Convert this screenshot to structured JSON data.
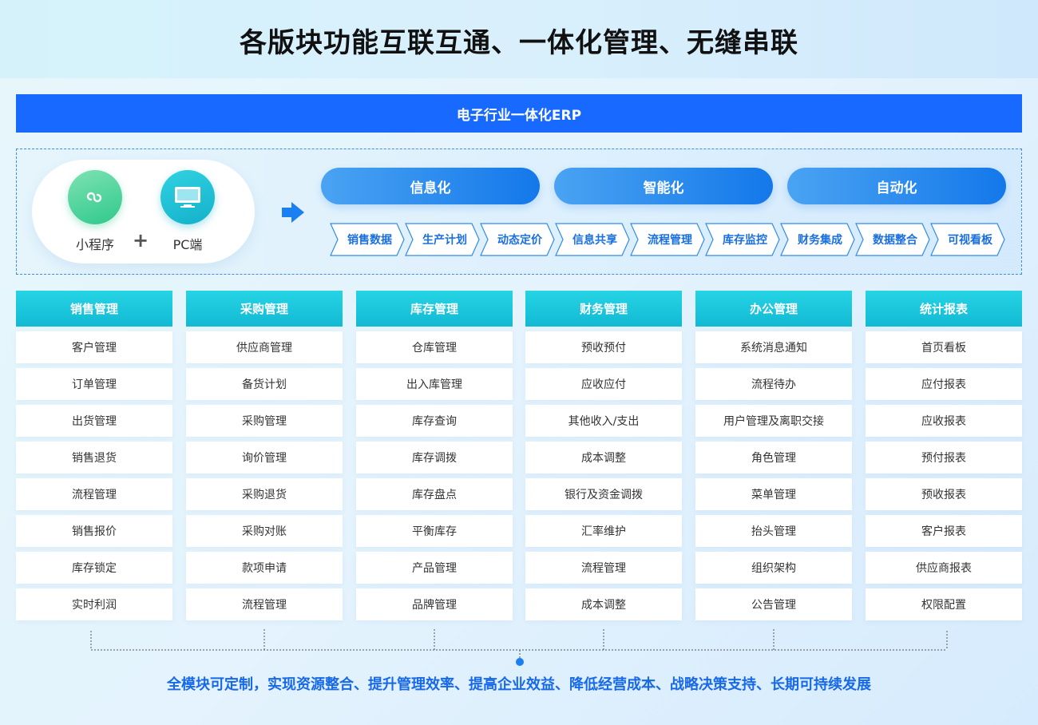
{
  "title": "各版块功能互联互通、一体化管理、无缝串联",
  "erp_bar": "电子行业一体化ERP",
  "platforms": [
    {
      "label": "小程序",
      "icon": "mini-program-icon"
    },
    {
      "label": "PC端",
      "icon": "monitor-icon"
    }
  ],
  "plus": "+",
  "categories": [
    "信息化",
    "智能化",
    "自动化"
  ],
  "features": [
    "销售数据",
    "生产计划",
    "动态定价",
    "信息共享",
    "流程管理",
    "库存监控",
    "财务集成",
    "数据整合",
    "可视看板"
  ],
  "modules": [
    {
      "header": "销售管理",
      "items": [
        "客户管理",
        "订单管理",
        "出货管理",
        "销售退货",
        "流程管理",
        "销售报价",
        "库存锁定",
        "实时利润"
      ]
    },
    {
      "header": "采购管理",
      "items": [
        "供应商管理",
        "备货计划",
        "采购管理",
        "询价管理",
        "采购退货",
        "采购对账",
        "款项申请",
        "流程管理"
      ]
    },
    {
      "header": "库存管理",
      "items": [
        "仓库管理",
        "出入库管理",
        "库存查询",
        "库存调拨",
        "库存盘点",
        "平衡库存",
        "产品管理",
        "品牌管理"
      ]
    },
    {
      "header": "财务管理",
      "items": [
        "预收预付",
        "应收应付",
        "其他收入/支出",
        "成本调整",
        "银行及资金调拨",
        "汇率维护",
        "流程管理",
        "成本调整"
      ]
    },
    {
      "header": "办公管理",
      "items": [
        "系统消息通知",
        "流程待办",
        "用户管理及离职交接",
        "角色管理",
        "菜单管理",
        "抬头管理",
        "组织架构",
        "公告管理"
      ]
    },
    {
      "header": "统计报表",
      "items": [
        "首页看板",
        "应付报表",
        "应收报表",
        "预付报表",
        "预收报表",
        "客户报表",
        "供应商报表",
        "权限配置"
      ]
    }
  ],
  "footer": "全模块可定制，实现资源整合、提升管理效率、提高企业效益、降低经营成本、战略决策支持、长期可持续发展",
  "colors": {
    "primary": "#1769ff",
    "teal": "#12b9d4",
    "footer_text": "#1769e8"
  }
}
